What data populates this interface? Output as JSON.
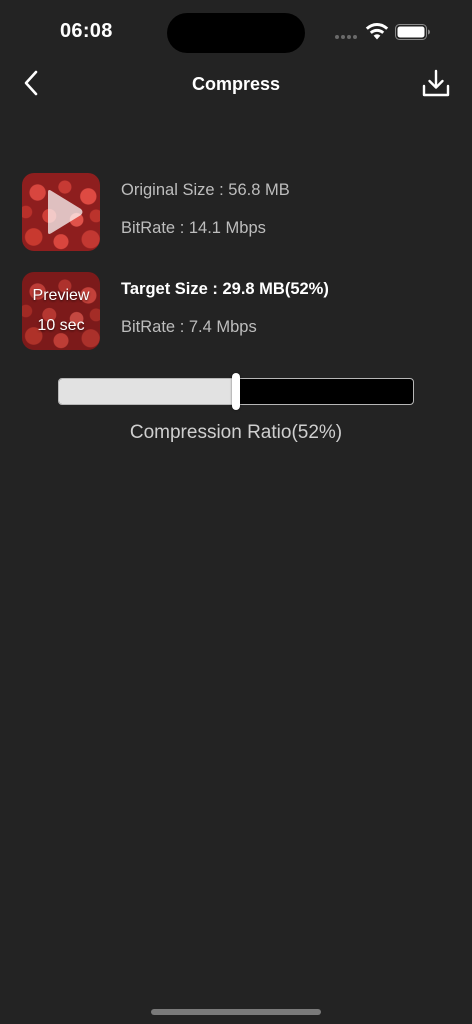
{
  "status_bar": {
    "time": "06:08"
  },
  "nav": {
    "title": "Compress",
    "back_icon": "chevron-left-icon",
    "download_icon": "download-icon"
  },
  "original": {
    "size_label": "Original Size : 56.8 MB",
    "bitrate_label": "BitRate : 14.1 Mbps",
    "thumbnail_icon": "play-icon"
  },
  "target": {
    "size_label": "Target Size : 29.8 MB(52%)",
    "bitrate_label": "BitRate : 7.4 Mbps",
    "preview_label": "Preview",
    "preview_duration": "10 sec"
  },
  "compression": {
    "ratio_label": "Compression Ratio(52%)",
    "ratio_value": 0.5
  },
  "colors": {
    "background": "#232323",
    "slider_fill": "#e2e2e2",
    "slider_track": "#000000"
  }
}
